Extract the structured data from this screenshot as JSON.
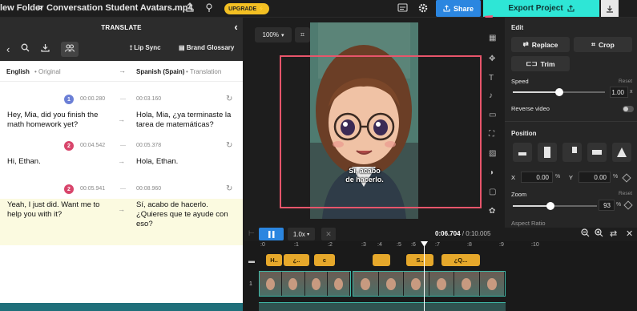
{
  "topbar": {
    "breadcrumb_folder": "lew Folder",
    "breadcrumb_sep": ">",
    "file_name": "Conversation Student Avatars.mp4",
    "upgrade_label": "UPGRADE",
    "share_label": "Share",
    "export_label": "Export Project"
  },
  "translate_panel": {
    "title": "TRANSLATE",
    "lip_sync_label": "Lip Sync",
    "brand_glossary_label": "Brand Glossary",
    "source_lang": "English",
    "source_sub": "Original",
    "target_lang": "Spanish (Spain)",
    "target_sub": "Translation",
    "segments": [
      {
        "speaker": "1",
        "start": "00:00.280",
        "end": "00:03.160",
        "source": "Hey, Mia, did you finish the math homework yet?",
        "target": "Hola, Mia, ¿ya terminaste la tarea de matemáticas?",
        "color": "#6b7fd6"
      },
      {
        "speaker": "2",
        "start": "00:04.542",
        "end": "00:05.378",
        "source": "Hi, Ethan.",
        "target": "Hola, Ethan.",
        "color": "#d8456b"
      },
      {
        "speaker": "2",
        "start": "00:05.941",
        "end": "00:08.960",
        "source": "Yeah, I just did. Want me to help you with it?",
        "target": "Sí, acabo de hacerlo. ¿Quieres que te ayude con eso?",
        "color": "#d8456b"
      }
    ]
  },
  "stage": {
    "zoom_value": "100%",
    "subtitle_text": "Sí, acabo de hacerlo."
  },
  "edit_panel": {
    "edit_title": "Edit",
    "replace_label": "Replace",
    "crop_label": "Crop",
    "trim_label": "Trim",
    "speed_label": "Speed",
    "speed_reset": "Reset",
    "speed_value": "1.00",
    "speed_unit": "x",
    "speed_fraction": 0.5,
    "reverse_label": "Reverse video",
    "position_title": "Position",
    "x_label": "X",
    "x_value": "0.00",
    "y_label": "Y",
    "y_value": "0.00",
    "pct": "%",
    "zoom_label": "Zoom",
    "zoom_reset": "Reset",
    "zoom_value": "93",
    "zoom_fraction": 0.45,
    "aspect_label": "Aspect Ratio"
  },
  "timeline": {
    "speed_label": "1.0x",
    "current_time": "0:06.704",
    "total_time": "0:10.005",
    "time_sep": " / ",
    "ruler_ticks": [
      ":0",
      ":1",
      ":2",
      ":3",
      ":4",
      ":5",
      ":6",
      ":7",
      ":8",
      ":9",
      ":10"
    ],
    "subtitle_chips": [
      "H..",
      "¿..",
      "c",
      "",
      "S..",
      "¿Q..."
    ],
    "track_number": "1"
  },
  "colors": {
    "accent_teal": "#2ee6d6",
    "share_blue": "#2b86e0",
    "upgrade_yellow": "#f3c023",
    "highlight_red": "#e8556b",
    "chip_orange": "#e6a82b"
  }
}
